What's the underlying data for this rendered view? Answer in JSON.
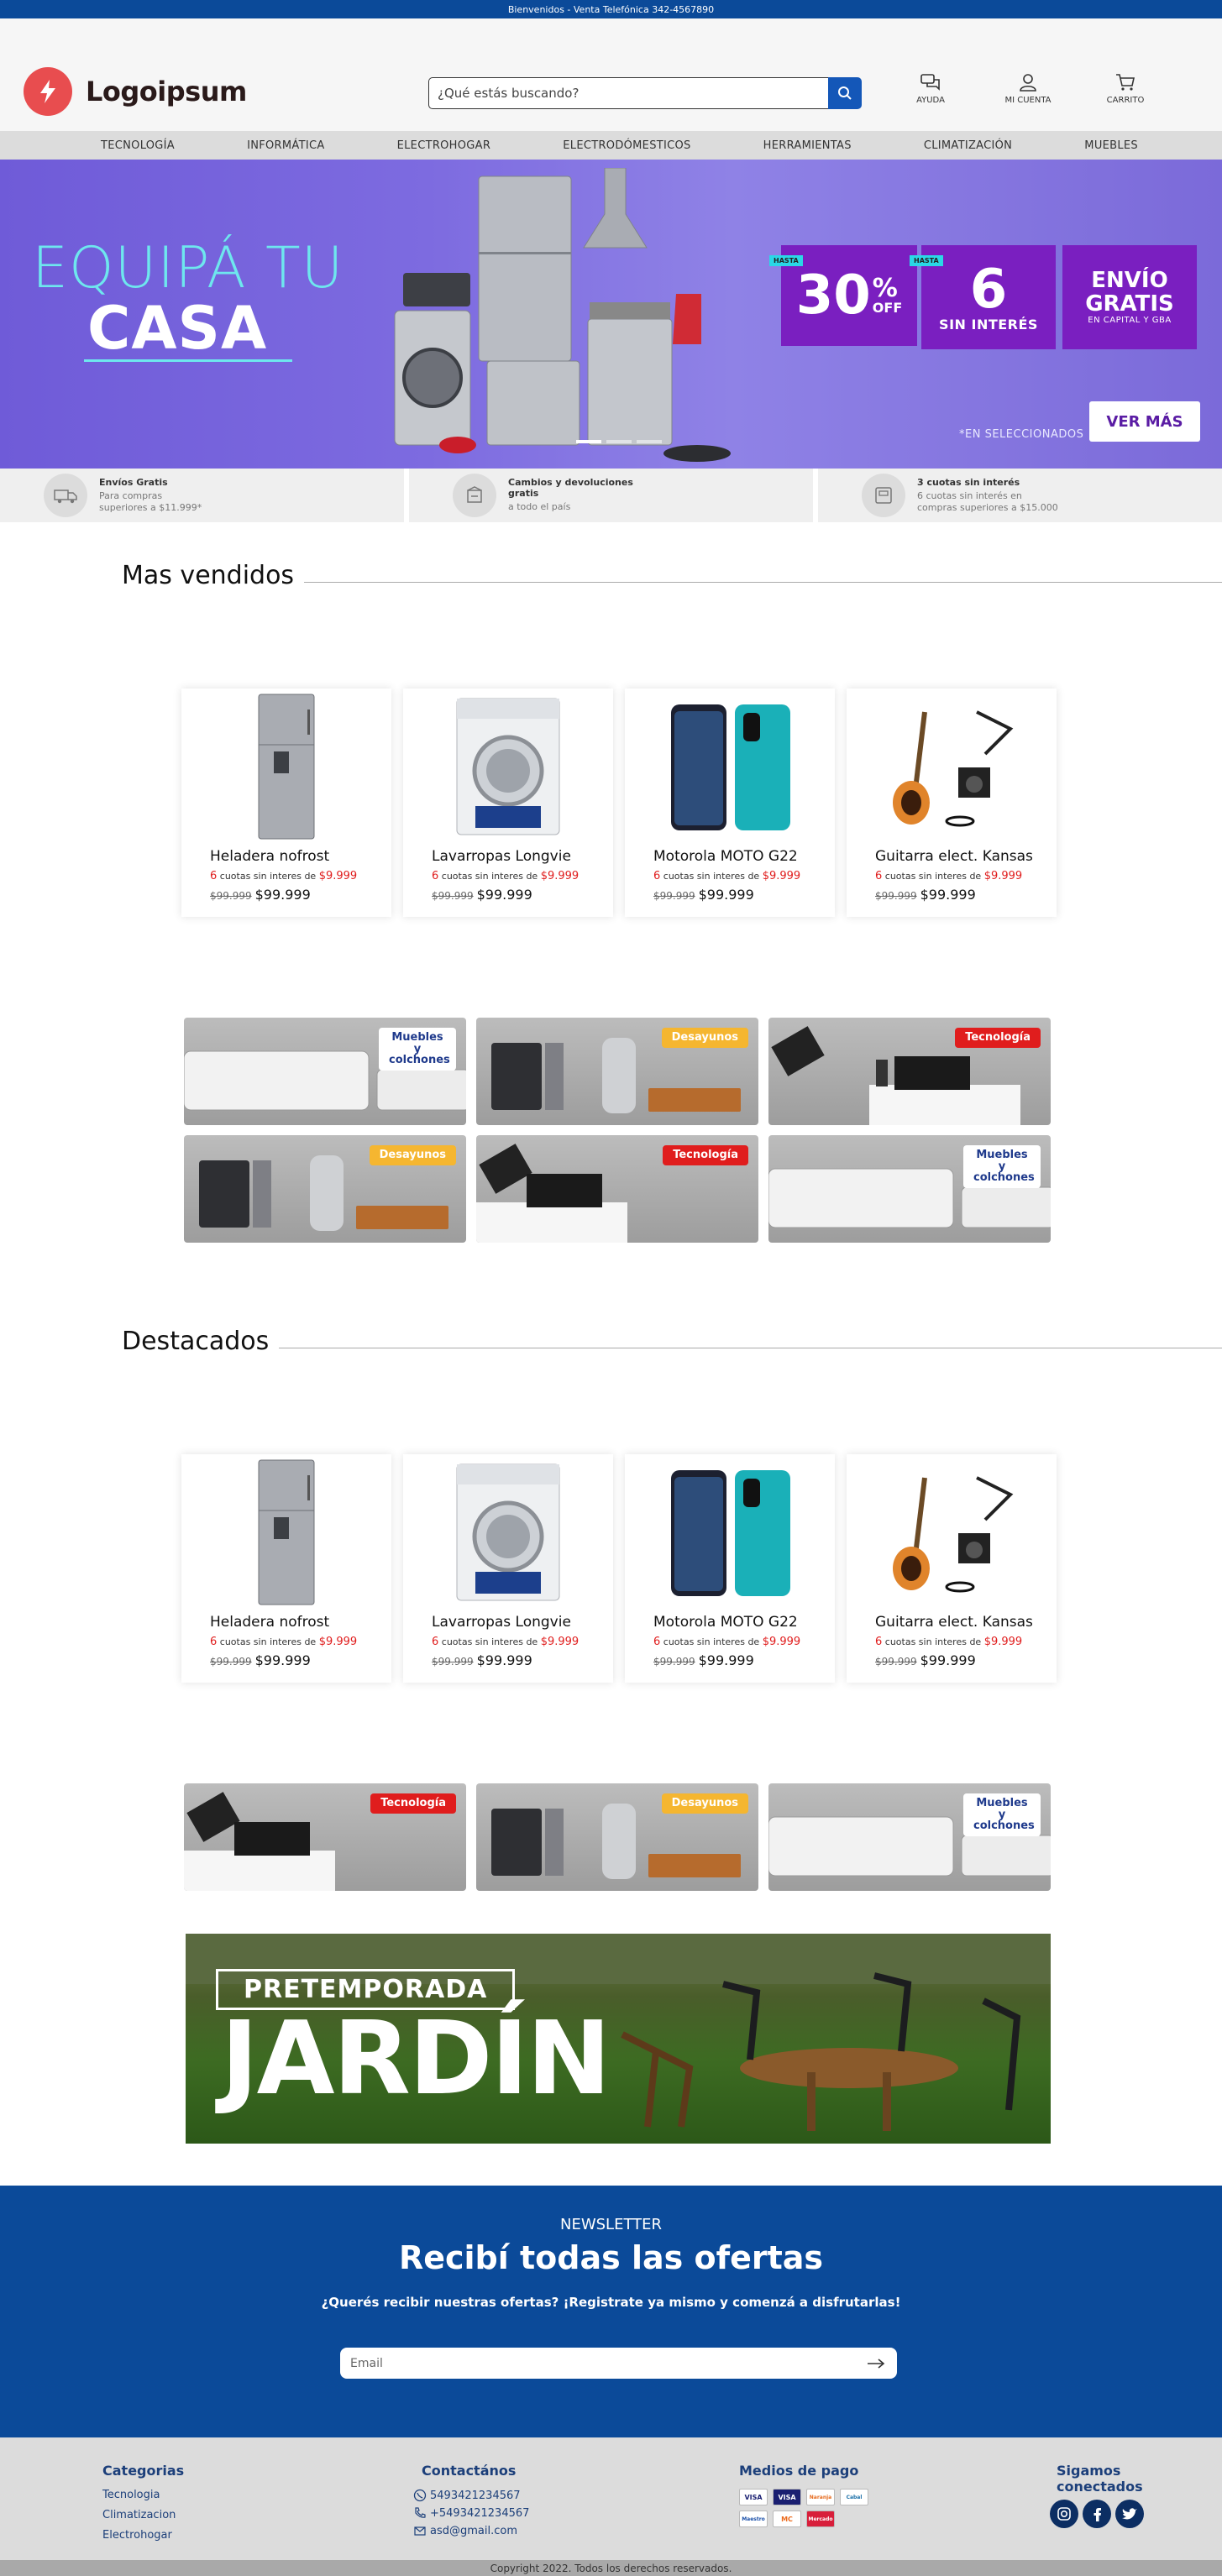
{
  "topbar": {
    "text": "Bienvenidos - Venta Telefónica 342-4567890"
  },
  "brand": {
    "name": "Logoipsum"
  },
  "search": {
    "placeholder": "¿Qué estás buscando?"
  },
  "header_actions": [
    {
      "label": "AYUDA",
      "icon": "chat-help-icon"
    },
    {
      "label": "MI CUENTA",
      "icon": "user-icon"
    },
    {
      "label": "CARRITO",
      "icon": "cart-icon"
    }
  ],
  "nav": [
    "TECNOLOGÍA",
    "INFORMÁTICA",
    "ELECTROHOGAR",
    "ELECTRODÓMESTICOS",
    "HERRAMIENTAS",
    "CLIMATIZACIÓN",
    "MUEBLES"
  ],
  "hero": {
    "line1": "EQUIPÁ TU",
    "line2": "CASA",
    "promo1": {
      "tag": "HASTA",
      "big": "30",
      "pct": "%",
      "off": "OFF"
    },
    "promo2": {
      "tag": "HASTA",
      "big": "6",
      "sub": "SIN INTERÉS"
    },
    "promo3": {
      "big": "ENVÍO GRATIS",
      "sub": "EN CAPITAL Y GBA"
    },
    "note": "*EN SELECCIONADOS",
    "cta": "VER MÁS",
    "slides": 3,
    "active_slide": 1
  },
  "benefits": [
    {
      "title": "Envíos Gratis",
      "sub": "Para compras superiores a $11.999*",
      "icon": "truck-icon"
    },
    {
      "title": "Cambios y devoluciones gratis",
      "sub": "a todo el país",
      "icon": "return-box-icon"
    },
    {
      "title": "3 cuotas sin interés",
      "sub": "6 cuotas sin interés en compras superiores a $15.000",
      "icon": "card-payment-icon"
    }
  ],
  "sections": {
    "best_sellers": "Mas vendidos",
    "featured": "Destacados"
  },
  "products": [
    {
      "name": "Heladera nofrost",
      "cuotas": "6",
      "cuotas_text": "cuotas sin interes de",
      "cuota_price": "$9.999",
      "old_price": "$99.999",
      "price": "$99.999"
    },
    {
      "name": "Lavarropas Longvie",
      "cuotas": "6",
      "cuotas_text": "cuotas sin interes de",
      "cuota_price": "$9.999",
      "old_price": "$99.999",
      "price": "$99.999"
    },
    {
      "name": "Motorola MOTO G22",
      "cuotas": "6",
      "cuotas_text": "cuotas sin interes de",
      "cuota_price": "$9.999",
      "old_price": "$99.999",
      "price": "$99.999"
    },
    {
      "name": "Guitarra elect. Kansas",
      "cuotas": "6",
      "cuotas_text": "cuotas sin interes de",
      "cuota_price": "$9.999",
      "old_price": "$99.999",
      "price": "$99.999"
    }
  ],
  "category_banners": {
    "muebles": "Muebles y colchones",
    "desayunos": "Desayunos",
    "tecnologia": "Tecnología"
  },
  "garden": {
    "line1": "PRETEMPORADA",
    "line2": "JARDÍN"
  },
  "newsletter": {
    "kicker": "NEWSLETTER",
    "title": "Recibí todas las ofertas",
    "sub": "¿Querés recibir nuestras ofertas? ¡Registrate ya mismo y comenzá a disfrutarlas!",
    "placeholder": "Email"
  },
  "footer": {
    "categories_title": "Categorias",
    "categories": [
      "Tecnologia",
      "Climatizacion",
      "Electrohogar"
    ],
    "contact_title": "Contactános",
    "contacts": [
      "5493421234567",
      "+5493421234567",
      "asd@gmail.com"
    ],
    "payment_title": "Medios de pago",
    "payments": [
      "VISA",
      "VISA",
      "Naranja",
      "Cabal",
      "Maestro",
      "MC",
      "Mercado"
    ],
    "social_title": "Sigamos conectados",
    "social": [
      "instagram-icon",
      "facebook-icon",
      "twitter-icon"
    ]
  },
  "copyright": "Copyright 2022. Todos los derechos reservados."
}
